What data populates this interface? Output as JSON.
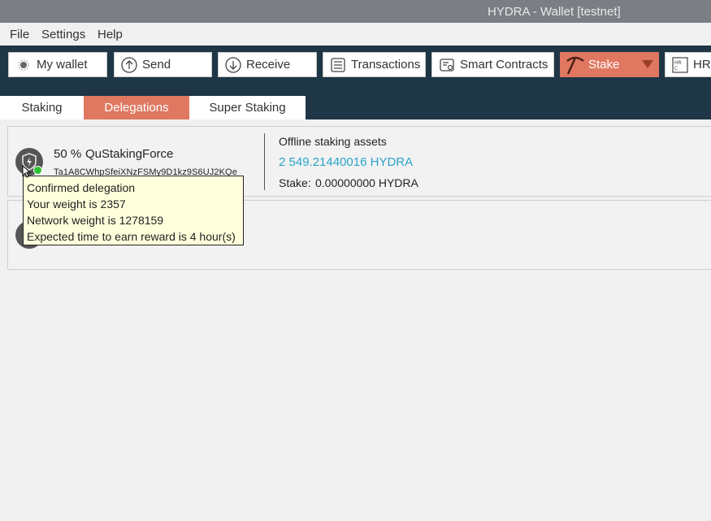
{
  "window": {
    "title": "HYDRA - Wallet [testnet]"
  },
  "menu": {
    "file": "File",
    "settings": "Settings",
    "help": "Help"
  },
  "toolbar": {
    "my_wallet": "My wallet",
    "send": "Send",
    "receive": "Receive",
    "transactions": "Transactions",
    "smart_contracts": "Smart Contracts",
    "stake": "Stake",
    "hrc": "HRC"
  },
  "tabs": {
    "staking": "Staking",
    "delegations": "Delegations",
    "super_staking": "Super Staking"
  },
  "delegation": {
    "fee": "50 %",
    "staker_name": "QuStakingForce",
    "address": "Ta1A8CWhpSfeiXNzFSMy9D1kz9S6UJ2KQe",
    "assets_label": "Offline staking assets",
    "assets_amount": "2 549.21440016 HYDRA",
    "stake_label": "Stake:",
    "stake_amount": "0.00000000 HYDRA"
  },
  "tooltip": {
    "line1": "Confirmed delegation",
    "line2": "Your weight is 2357",
    "line3": "Network weight is 1278159",
    "line4": "Expected time to earn reward is 4 hour(s)"
  },
  "colors": {
    "accent": "#e07861",
    "toolbar_bg": "#1e3645",
    "amount": "#2aa3c9",
    "status_ok": "#2ec02e"
  }
}
